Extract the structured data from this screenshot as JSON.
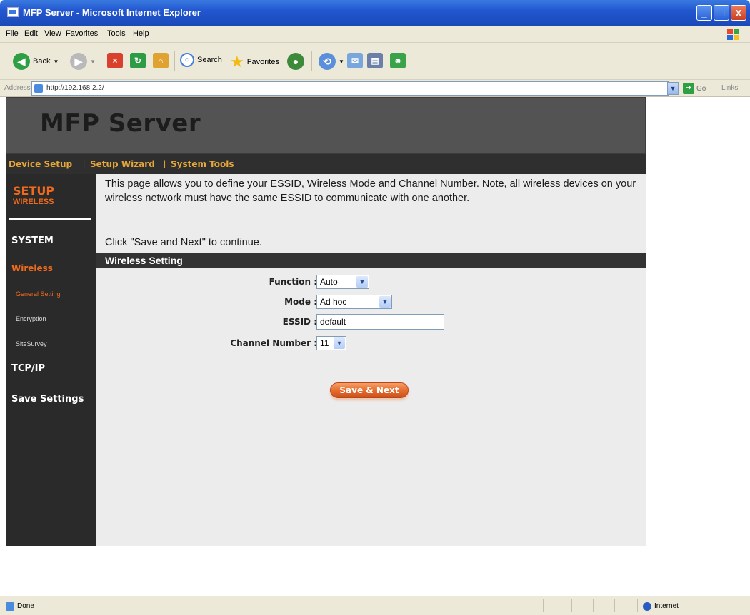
{
  "window": {
    "title": "MFP Server - Microsoft Internet Explorer",
    "min_glyph": "_",
    "max_glyph": "□",
    "close_glyph": "X"
  },
  "menu": [
    "File",
    "Edit",
    "View",
    "Favorites",
    "Tools",
    "Help"
  ],
  "toolbar": {
    "back_label": "Back",
    "search_label": "Search",
    "favorites_label": "Favorites"
  },
  "address": {
    "label": "Address",
    "url": "http://192.168.2.2/",
    "go_label": "Go",
    "links_label": "Links"
  },
  "banner": {
    "brand": "MFP Server"
  },
  "nav": {
    "links": [
      "Device Setup",
      "Setup Wizard",
      "System Tools"
    ],
    "separator": "|"
  },
  "sidebar": {
    "title": "SETUP",
    "subtitle": "WIRELESS",
    "items": [
      {
        "label": "SYSTEM"
      },
      {
        "label": "Wireless"
      },
      {
        "label": "General Setting"
      },
      {
        "label": "Encryption"
      },
      {
        "label": "SiteSurvey"
      },
      {
        "label": "TCP/IP"
      },
      {
        "label": "Save Settings"
      }
    ]
  },
  "content": {
    "intro": "This page allows you to define your ESSID, Wireless Mode and Channel Number. Note, all wireless devices on your wireless network must have the same ESSID to communicate with one another.",
    "hint": "Click \"Save and Next\" to continue.",
    "section_title": "Wireless Setting"
  },
  "form": {
    "function": {
      "label": "Function :",
      "value": "Auto"
    },
    "mode": {
      "label": "Mode :",
      "value": "Ad hoc"
    },
    "essid": {
      "label": "ESSID :",
      "value": "default"
    },
    "channel": {
      "label": "Channel Number :",
      "value": "11"
    },
    "submit": "Save & Next"
  },
  "status": {
    "text": "Done",
    "zone": "Internet"
  },
  "colors": {
    "accent_orange": "#f06a1c",
    "nav_link": "#e6a73a",
    "banner_bg": "#535353",
    "sidebar_bg": "#2a2a2a",
    "content_bg": "#ececec"
  }
}
